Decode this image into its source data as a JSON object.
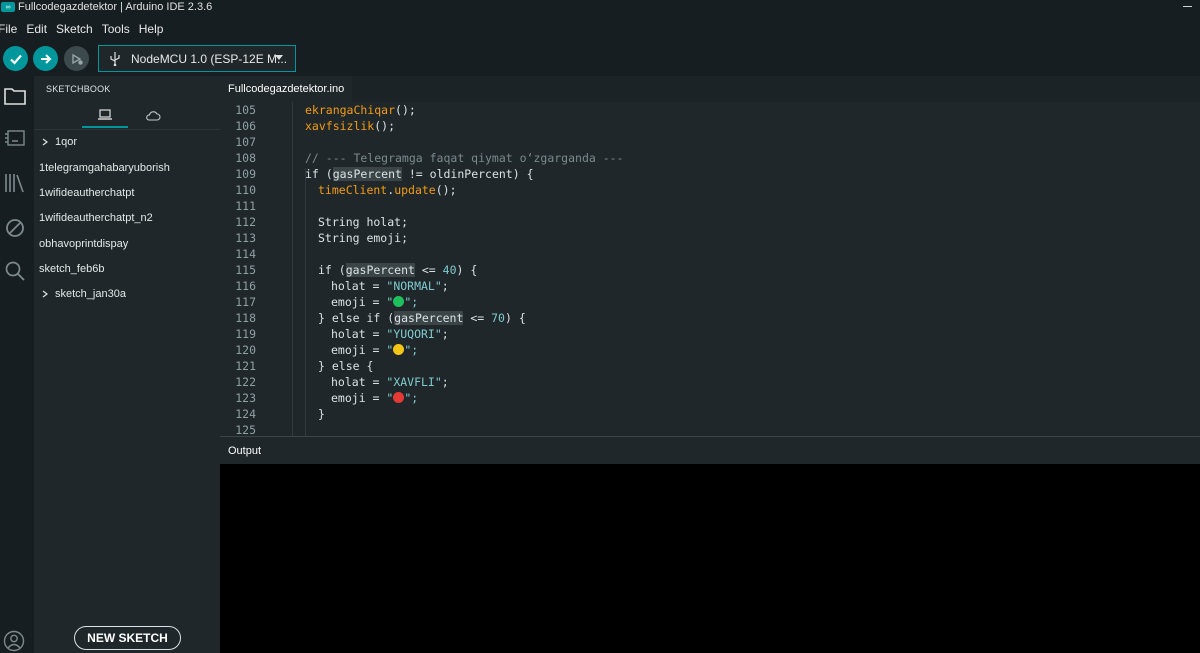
{
  "window": {
    "title": "Fullcodegazdetektor | Arduino IDE 2.3.6",
    "logo_text": "∞"
  },
  "menu": [
    "File",
    "Edit",
    "Sketch",
    "Tools",
    "Help"
  ],
  "toolbar": {
    "board": "NodeMCU 1.0 (ESP-12E M..."
  },
  "sidebar": {
    "title": "SKETCHBOOK",
    "items": [
      {
        "label": "1qor",
        "folder": true
      },
      {
        "label": "1telegramgahabaryuborish",
        "folder": false
      },
      {
        "label": "1wifideautherchatpt",
        "folder": false
      },
      {
        "label": "1wifideautherchatpt_n2",
        "folder": false
      },
      {
        "label": "obhavoprintdispay",
        "folder": false
      },
      {
        "label": "sketch_feb6b",
        "folder": false
      },
      {
        "label": "sketch_jan30a",
        "folder": true
      }
    ],
    "new_sketch": "NEW SKETCH"
  },
  "editor": {
    "tab": "Fullcodegazdetektor.ino",
    "line_numbers": [
      "105",
      "106",
      "107",
      "108",
      "109",
      "110",
      "111",
      "112",
      "113",
      "114",
      "115",
      "116",
      "117",
      "118",
      "119",
      "120",
      "121",
      "122",
      "123",
      "124",
      "125"
    ],
    "lines": {
      "l105": {
        "a": "ekrangaChiqar",
        "b": "();"
      },
      "l106": {
        "a": "xavfsizlik",
        "b": "();"
      },
      "l108": "// --- Telegramga faqat qiymat o‘zgarganda ---",
      "l109": {
        "a": "if (",
        "b": "gasPercent",
        "c": " != oldinPercent) {"
      },
      "l110": {
        "a": "timeClient",
        "b": ".",
        "c": "update",
        "d": "();"
      },
      "l112": "String holat;",
      "l113": "String emoji;",
      "l115": {
        "a": "if (",
        "b": "gasPercent",
        "c": " <= ",
        "d": "40",
        "e": ") {"
      },
      "l116": {
        "a": "holat = ",
        "b": "\"NORMAL\"",
        "c": ";"
      },
      "l117": {
        "a": "emoji = ",
        "b": "\"",
        "c": "\";"
      },
      "l118": {
        "a": "} else if (",
        "b": "gasPercent",
        "c": " <= ",
        "d": "70",
        "e": ") {"
      },
      "l119": {
        "a": "holat = ",
        "b": "\"YUQORI\"",
        "c": ";"
      },
      "l120": {
        "a": "emoji = ",
        "b": "\"",
        "c": "\";"
      },
      "l121": "} else {",
      "l122": {
        "a": "holat = ",
        "b": "\"XAVFLI\"",
        "c": ";"
      },
      "l123": {
        "a": "emoji = ",
        "b": "\"",
        "c": "\";"
      },
      "l124": "}"
    },
    "emoji_colors": {
      "green": "#1fbf5b",
      "yellow": "#f5c518",
      "red": "#e53935"
    }
  },
  "output": {
    "title": "Output"
  },
  "colors": {
    "accent": "#00979c",
    "background": "#171e21",
    "panel": "#1f272a"
  }
}
